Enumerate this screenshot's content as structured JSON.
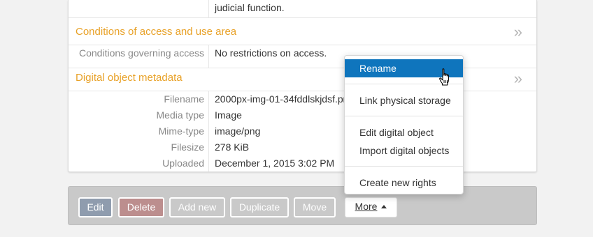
{
  "record": {
    "prev_text": "judicial function.",
    "access_section": {
      "title": "Conditions of access and use area",
      "fields": [
        {
          "label": "Conditions governing access",
          "value": "No restrictions on access."
        }
      ]
    },
    "digital_section": {
      "title": "Digital object metadata",
      "fields": [
        {
          "label": "Filename",
          "value": "2000px-img-01-34fddlskjdsf.png"
        },
        {
          "label": "Media type",
          "value": "Image"
        },
        {
          "label": "Mime-type",
          "value": "image/png"
        },
        {
          "label": "Filesize",
          "value": "278 KiB"
        },
        {
          "label": "Uploaded",
          "value": "December 1, 2015 3:02 PM"
        }
      ]
    },
    "chevron": "»"
  },
  "actions": {
    "edit": "Edit",
    "delete": "Delete",
    "add_new": "Add new",
    "duplicate": "Duplicate",
    "move": "Move",
    "more": "More"
  },
  "menu": {
    "items": [
      {
        "label": "Rename"
      },
      {
        "label": "Link physical storage"
      },
      {
        "label": "Edit digital object"
      },
      {
        "label": "Import digital objects"
      },
      {
        "label": "Create new rights"
      }
    ]
  },
  "colors": {
    "section_title": "#e8a127",
    "menu_highlight": "#0f75bd",
    "edit_button": "#8f9cae",
    "delete_button": "#bc8e8e"
  },
  "icons": {
    "cursor": "hand-pointer-icon",
    "section_toggle": "double-chevron-right-icon",
    "more_caret": "caret-up-icon"
  }
}
